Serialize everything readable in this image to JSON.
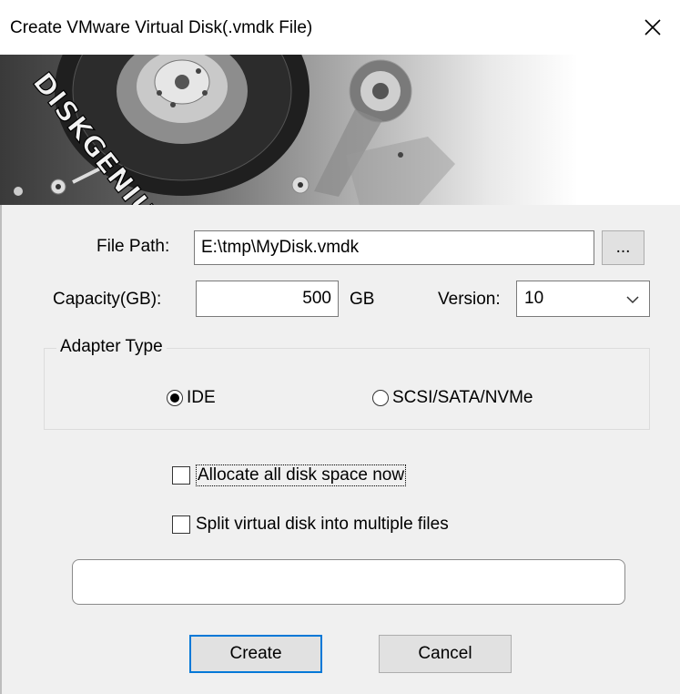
{
  "window": {
    "title": "Create VMware Virtual Disk(.vmdk File)",
    "close_icon": "close-icon"
  },
  "banner": {
    "logo_text": "DISKGENIUS"
  },
  "form": {
    "file_path_label": "File Path:",
    "file_path_value": "E:\\tmp\\MyDisk.vmdk",
    "browse_label": "...",
    "capacity_label": "Capacity(GB):",
    "capacity_value": "500",
    "capacity_unit": "GB",
    "version_label": "Version:",
    "version_value": "10"
  },
  "adapter": {
    "group_label": "Adapter Type",
    "options": [
      {
        "label": "IDE",
        "selected": true
      },
      {
        "label": "SCSI/SATA/NVMe",
        "selected": false
      }
    ]
  },
  "options": {
    "allocate_label": "Allocate all disk space now",
    "allocate_checked": false,
    "split_label": "Split virtual disk into multiple files",
    "split_checked": false
  },
  "progress": {
    "value": 0
  },
  "buttons": {
    "create_label": "Create",
    "cancel_label": "Cancel"
  },
  "colors": {
    "accent": "#0078d7",
    "dialog_bg": "#f0f0f0"
  }
}
